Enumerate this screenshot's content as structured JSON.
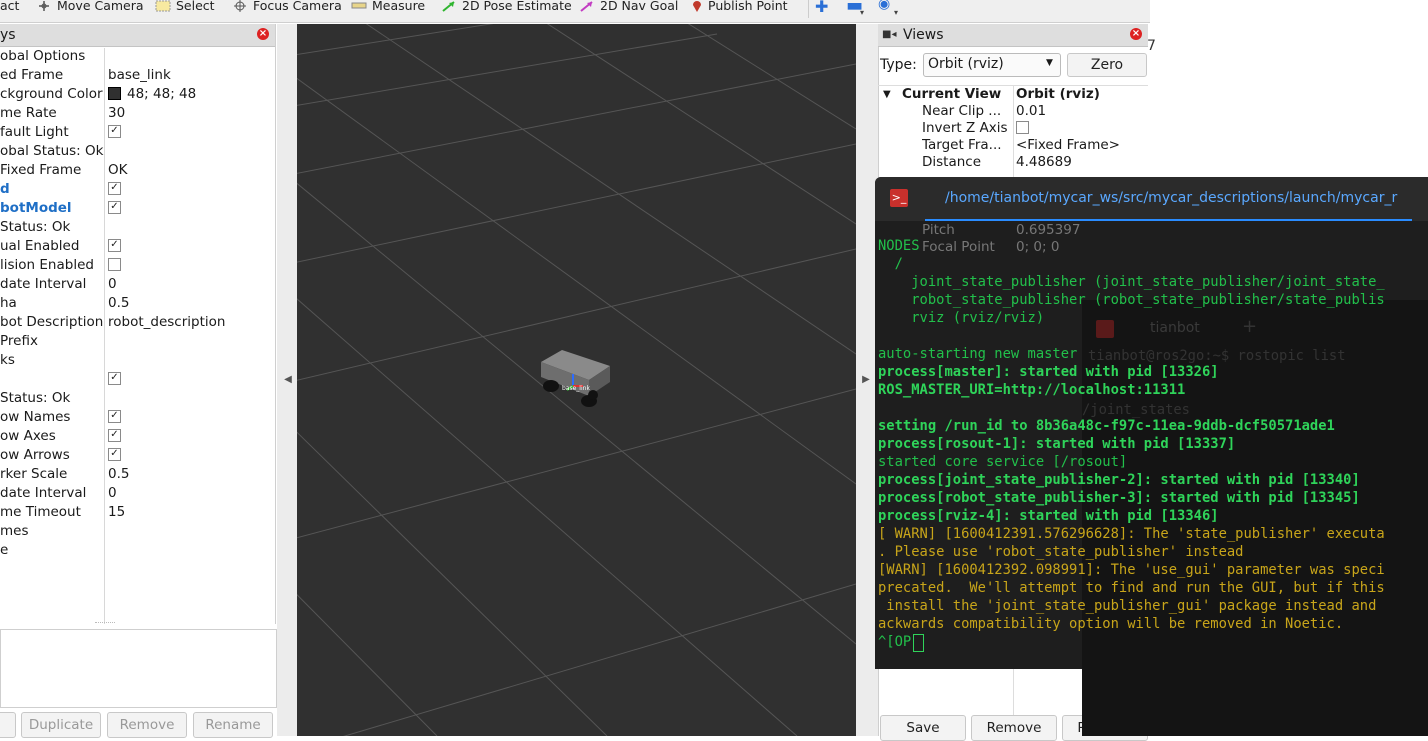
{
  "toolbar": {
    "items": [
      {
        "label": "act",
        "icon": "interact-icon"
      },
      {
        "label": "Move Camera",
        "icon": "move-camera-icon"
      },
      {
        "label": "Select",
        "icon": "select-icon"
      },
      {
        "label": "Focus Camera",
        "icon": "focus-camera-icon"
      },
      {
        "label": "Measure",
        "icon": "measure-icon"
      },
      {
        "label": "2D Pose Estimate",
        "icon": "pose-estimate-arrow-icon"
      },
      {
        "label": "2D Nav Goal",
        "icon": "nav-goal-arrow-icon"
      },
      {
        "label": "Publish Point",
        "icon": "publish-point-pin-icon"
      }
    ]
  },
  "displays": {
    "title": "ys",
    "rows": [
      {
        "key": "obal Options",
        "value": ""
      },
      {
        "key": "ed Frame",
        "value": "base_link"
      },
      {
        "key": "ckground Color",
        "value": "48; 48; 48"
      },
      {
        "key": "me Rate",
        "value": "30"
      },
      {
        "key": "fault Light",
        "value": "✓"
      },
      {
        "key": "obal Status: Ok",
        "value": ""
      },
      {
        "key": "Fixed Frame",
        "value": "OK"
      },
      {
        "key": "d",
        "value": "✓"
      },
      {
        "key": "botModel",
        "value": "✓"
      },
      {
        "key": "Status: Ok",
        "value": ""
      },
      {
        "key": "ual Enabled",
        "value": "✓"
      },
      {
        "key": "lision Enabled",
        "value": ""
      },
      {
        "key": "date Interval",
        "value": "0"
      },
      {
        "key": "ha",
        "value": "0.5"
      },
      {
        "key": "bot Description",
        "value": "robot_description"
      },
      {
        "key": "Prefix",
        "value": ""
      },
      {
        "key": "ks",
        "value": ""
      },
      {
        "key": "",
        "value": "✓"
      },
      {
        "key": "Status: Ok",
        "value": ""
      },
      {
        "key": "ow Names",
        "value": "✓"
      },
      {
        "key": "ow Axes",
        "value": "✓"
      },
      {
        "key": "ow Arrows",
        "value": "✓"
      },
      {
        "key": "rker Scale",
        "value": "0.5"
      },
      {
        "key": "date Interval",
        "value": "0"
      },
      {
        "key": "me Timeout",
        "value": "15"
      },
      {
        "key": "mes",
        "value": ""
      },
      {
        "key": "e",
        "value": ""
      }
    ],
    "buttons": [
      "Duplicate",
      "Remove",
      "Rename"
    ],
    "bg_swatch_color": "#303030"
  },
  "views": {
    "title": "Views",
    "type_label": "Type:",
    "type_value": "Orbit (rviz)",
    "zero_label": "Zero",
    "header_key": "Current View",
    "header_value": "Orbit (rviz)",
    "rows": [
      {
        "key": "Near Clip ...",
        "value": "0.01"
      },
      {
        "key": "Invert Z Axis",
        "value": ""
      },
      {
        "key": "Target Fra...",
        "value": "<Fixed Frame>"
      },
      {
        "key": "Distance",
        "value": "4.48689"
      }
    ],
    "hidden_rows": [
      {
        "key": "Pitch",
        "value": "0.695397"
      },
      {
        "key": "Focal Point",
        "value": "0; 0; 0"
      }
    ],
    "buttons": [
      "Save",
      "Remove",
      "Rename"
    ]
  },
  "terminal": {
    "tab_title": "/home/tianbot/mycar_ws/src/mycar_descriptions/launch/mycar_r",
    "lines": [
      {
        "text": "NODES",
        "style": "g"
      },
      {
        "text": "  /",
        "style": "g"
      },
      {
        "text": "    joint_state_publisher (joint_state_publisher/joint_state_",
        "style": "g"
      },
      {
        "text": "    robot_state_publisher (robot_state_publisher/state_publis",
        "style": "g"
      },
      {
        "text": "    rviz (rviz/rviz)",
        "style": "g"
      },
      {
        "text": "",
        "style": "g"
      },
      {
        "text": "auto-starting new master",
        "style": "g"
      },
      {
        "text": "process[master]: started with pid [13326]",
        "style": "gb"
      },
      {
        "text": "ROS_MASTER_URI=http://localhost:11311",
        "style": "gb"
      },
      {
        "text": "",
        "style": "g"
      },
      {
        "text": "setting /run_id to 8b36a48c-f97c-11ea-9ddb-dcf50571ade1",
        "style": "gb"
      },
      {
        "text": "process[rosout-1]: started with pid [13337]",
        "style": "gb"
      },
      {
        "text": "started core service [/rosout]",
        "style": "g"
      },
      {
        "text": "process[joint_state_publisher-2]: started with pid [13340]",
        "style": "gb"
      },
      {
        "text": "process[robot_state_publisher-3]: started with pid [13345]",
        "style": "gb"
      },
      {
        "text": "process[rviz-4]: started with pid [13346]",
        "style": "gb"
      },
      {
        "text": "[ WARN] [1600412391.576296628]: The 'state_publisher' executa",
        "style": "y"
      },
      {
        "text": ". Please use 'robot_state_publisher' instead",
        "style": "y"
      },
      {
        "text": "[WARN] [1600412392.098991]: The 'use_gui' parameter was speci",
        "style": "y"
      },
      {
        "text": "precated.  We'll attempt to find and run the GUI, but if this",
        "style": "y"
      },
      {
        "text": " install the 'joint_state_publisher_gui' package instead and",
        "style": "y"
      },
      {
        "text": "ackwards compatibility option will be removed in Noetic.",
        "style": "y"
      },
      {
        "text": "^[OP",
        "style": "g"
      }
    ],
    "background_tab": "tianbot",
    "background_lines": [
      "tianbot@ros2go:~$ rostopic list",
      "/joint_states"
    ]
  },
  "colors": {
    "viewport_bg": "#303030",
    "terminal_green": "#2fd45a",
    "terminal_yellow": "#c8a51a",
    "accent_blue": "#1f6fc6"
  }
}
